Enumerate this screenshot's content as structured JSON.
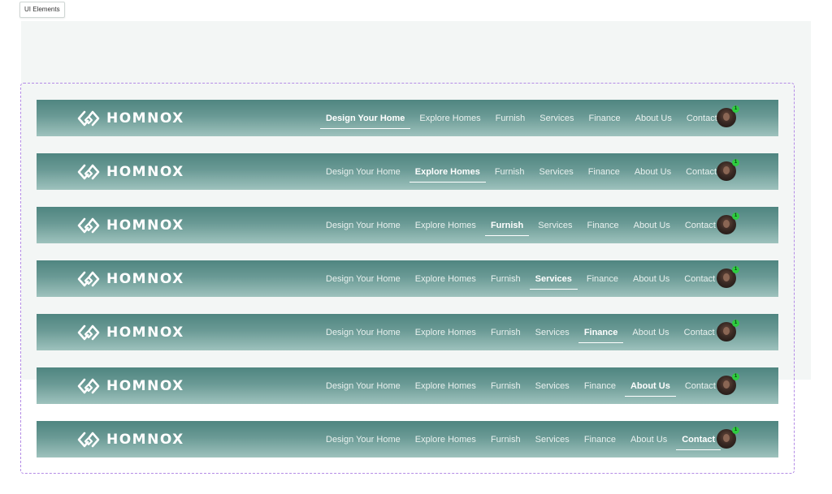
{
  "frame": {
    "label": "UI Elements"
  },
  "brand": {
    "name": "HOMNOX",
    "logo_icon": "linked-diamond-logo"
  },
  "menu_items": [
    "Design Your Home",
    "Explore Homes",
    "Furnish",
    "Services",
    "Finance",
    "About Us",
    "Contact"
  ],
  "navbars": [
    {
      "active": "Design Your Home",
      "notification_count": "1"
    },
    {
      "active": "Explore Homes",
      "notification_count": "1"
    },
    {
      "active": "Furnish",
      "notification_count": "1"
    },
    {
      "active": "Services",
      "notification_count": "1"
    },
    {
      "active": "Finance",
      "notification_count": "1"
    },
    {
      "active": "About Us",
      "notification_count": "1"
    },
    {
      "active": "Contact",
      "notification_count": "1"
    }
  ],
  "colors": {
    "nav_top": "#4f8580",
    "nav_bottom": "#9ec2bd",
    "text": "#ffffff",
    "badge": "#2ecc40",
    "selection_border": "#b48be6"
  }
}
